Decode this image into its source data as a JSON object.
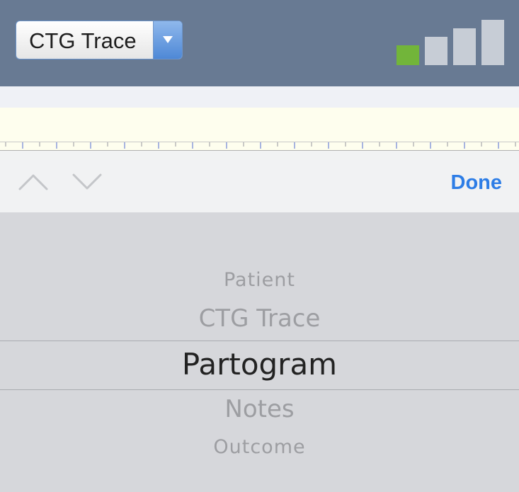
{
  "header": {
    "view_select": {
      "selected_label": "CTG Trace"
    },
    "signal": {
      "bars_active": 1,
      "bars_total": 4,
      "active_color": "#72b53a",
      "inactive_color": "#c7cdd6"
    }
  },
  "toolbar": {
    "prev_icon": "chevron-up-icon",
    "next_icon": "chevron-down-icon",
    "done_label": "Done"
  },
  "picker": {
    "options": [
      "Patient",
      "CTG Trace",
      "Partogram",
      "Notes",
      "Outcome"
    ],
    "selected_index": 2
  },
  "colors": {
    "header_bg": "#687a93",
    "accent": "#2d7de6",
    "picker_bg": "#d6d7db"
  }
}
